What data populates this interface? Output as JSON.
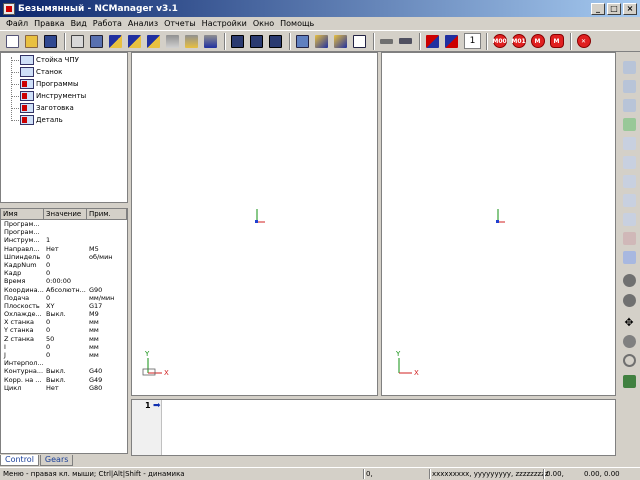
{
  "window": {
    "title": "Безымянный - NCManager v3.1",
    "minimize_glyph": "_",
    "maximize_glyph": "□",
    "close_glyph": "×"
  },
  "menu": [
    "Файл",
    "Правка",
    "Вид",
    "Работа",
    "Анализ",
    "Отчеты",
    "Настройки",
    "Окно",
    "Помощь"
  ],
  "toolbar": {
    "line_number": "1",
    "red_buttons": [
      "M00",
      "M01",
      "M",
      "M",
      ""
    ]
  },
  "tree": {
    "items": [
      "Стойка ЧПУ",
      "Станок",
      "Программы",
      "Инструменты",
      "Заготовка",
      "Деталь"
    ]
  },
  "properties": {
    "headers": [
      "Имя",
      "Значение",
      "Прим."
    ],
    "rows": [
      [
        "Програм...",
        "",
        ""
      ],
      [
        "Програм...",
        "",
        ""
      ],
      [
        "Инструм...",
        "1",
        ""
      ],
      [
        "Направл...",
        "Нет",
        "M5"
      ],
      [
        "Шпиндель",
        "0",
        "об/мин"
      ],
      [
        "КадрNum",
        "0",
        ""
      ],
      [
        "Кадр",
        "0",
        ""
      ],
      [
        "Время",
        "0:00:00",
        ""
      ],
      [
        "Координа...",
        "Абсолютн...",
        "G90"
      ],
      [
        "Подача",
        "0",
        "мм/мин"
      ],
      [
        "Плоскость",
        "XY",
        "G17"
      ],
      [
        "Охлажде...",
        "Выкл.",
        "M9"
      ],
      [
        "X станка",
        "0",
        "мм"
      ],
      [
        "Y станка",
        "0",
        "мм"
      ],
      [
        "Z станка",
        "50",
        "мм"
      ],
      [
        "I",
        "0",
        "мм"
      ],
      [
        "J",
        "0",
        "мм"
      ],
      [
        "Интерпол...",
        "",
        ""
      ],
      [
        "Контурна...",
        "Выкл.",
        "G40"
      ],
      [
        "Корр. на ...",
        "Выкл.",
        "G49"
      ],
      [
        "Цикл",
        "Нет",
        "G80"
      ]
    ]
  },
  "tabs": [
    "Control",
    "Gears"
  ],
  "viewports": {
    "axis_x": "X",
    "axis_y": "Y"
  },
  "editor": {
    "line": "1"
  },
  "status": {
    "message": "Меню - правая кл. мыши; Ctrl|Alt|Shift - динамика",
    "a": "0,",
    "b": "xxxxxxxxx, yyyyyyyyy, zzzzzzzzz",
    "c": "0.00,",
    "d": "0.00,    0.00"
  },
  "colors": {
    "title_start": "#0a246a",
    "title_end": "#a6caf0",
    "axis_x": "#d02020",
    "axis_y": "#109010",
    "axis_z": "#2040d0"
  }
}
